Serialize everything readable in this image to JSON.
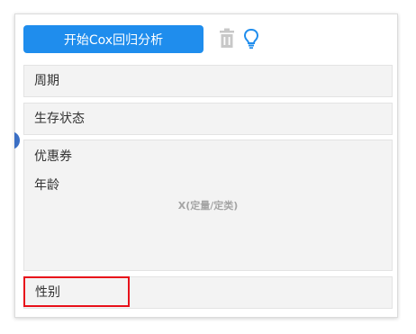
{
  "toolbar": {
    "run_button_label": "开始Cox回归分析",
    "delete_icon": "trash-icon",
    "tip_icon": "lightbulb-icon"
  },
  "fields": {
    "period": {
      "label": "周期"
    },
    "status": {
      "label": "生存状态"
    },
    "x": {
      "items": [
        "优惠券",
        "年龄"
      ],
      "hint": "X(定量/定类)"
    },
    "strata": {
      "items": [
        "性别"
      ]
    }
  },
  "colors": {
    "primary": "#1f8ded",
    "highlight": "#e8101a",
    "icon": "#c8c8c8",
    "tip_icon": "#1f8ded"
  }
}
